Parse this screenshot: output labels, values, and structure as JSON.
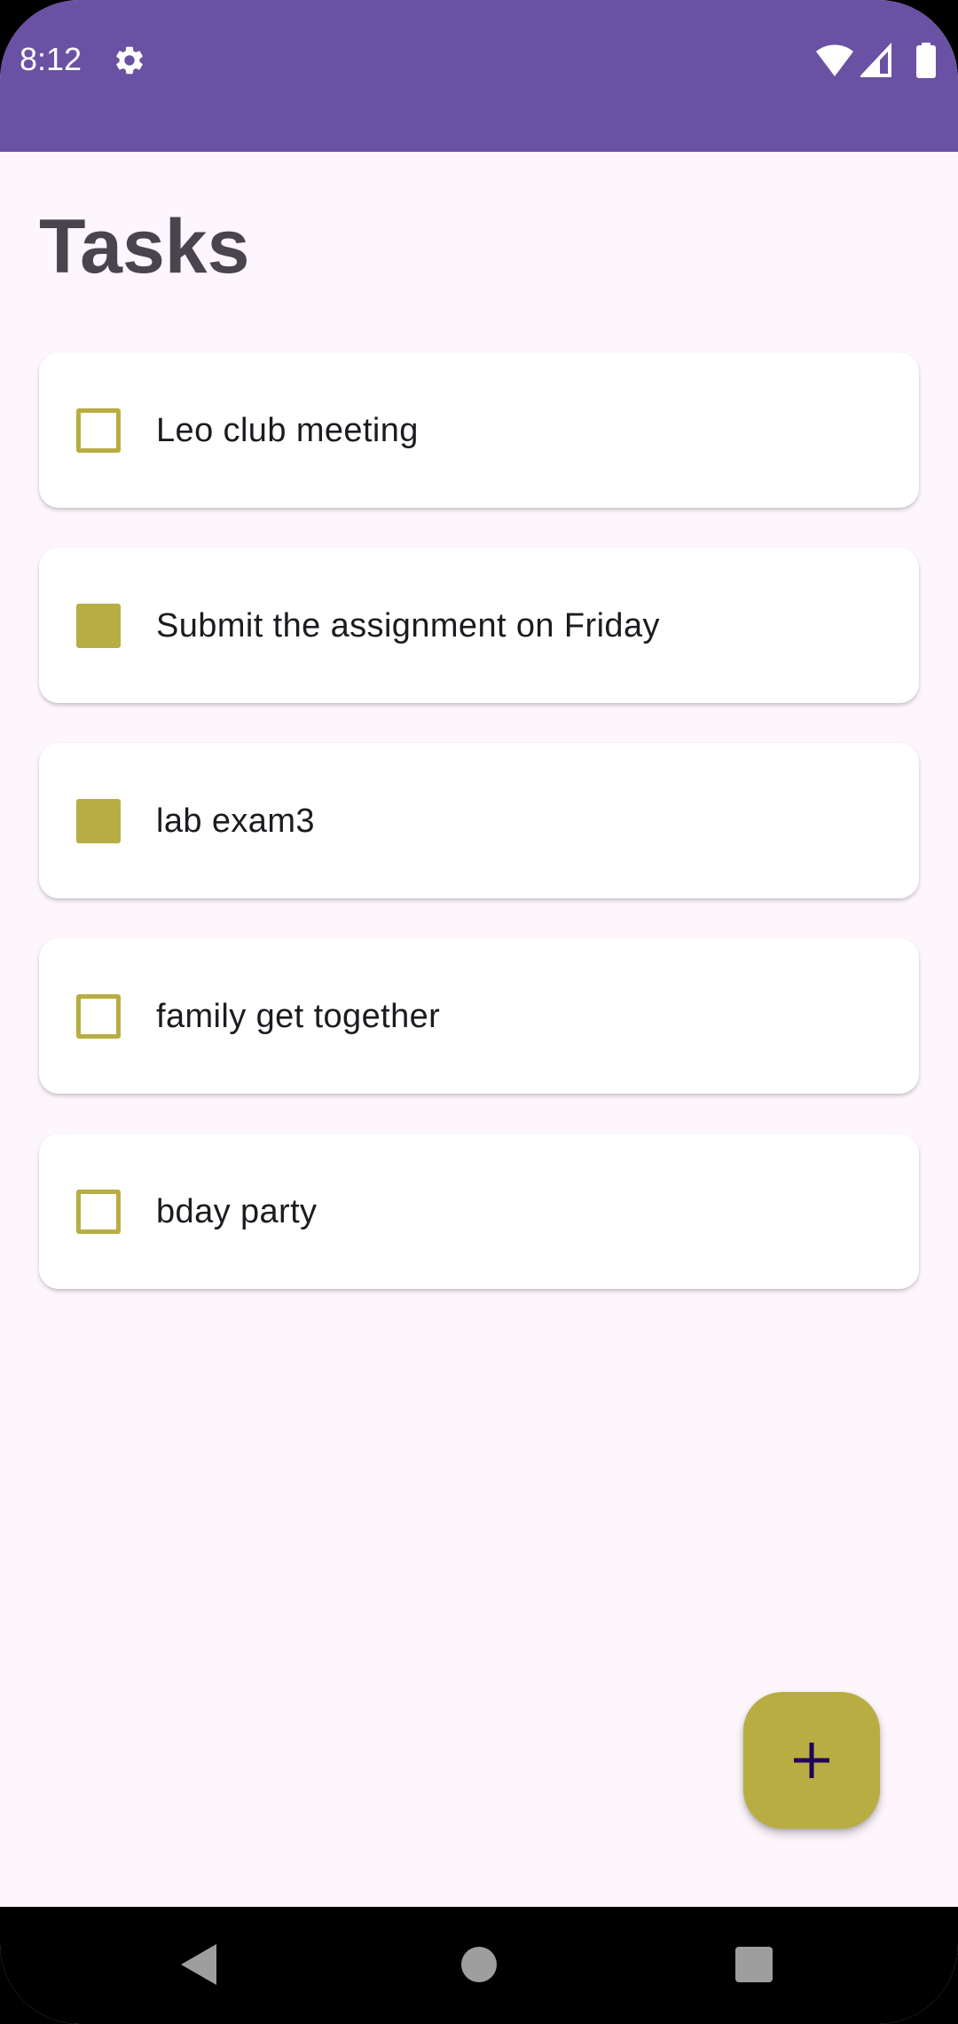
{
  "status_bar": {
    "time": "8:12",
    "background_color": "#6a51a3",
    "icons": [
      "settings-gear-icon",
      "wifi-icon",
      "cell-signal-icon",
      "battery-icon"
    ]
  },
  "screen": {
    "title": "Tasks"
  },
  "tasks": [
    {
      "label": "Leo club meeting",
      "checked": false
    },
    {
      "label": "Submit the assignment on Friday",
      "checked": true
    },
    {
      "label": "lab exam3",
      "checked": true
    },
    {
      "label": "family get together",
      "checked": false
    },
    {
      "label": "bday party",
      "checked": false
    }
  ],
  "fab": {
    "icon": "plus-icon",
    "color": "#b8ad42"
  },
  "navigation_bar": {
    "icons": [
      "back-icon",
      "home-icon",
      "recents-icon"
    ]
  },
  "colors": {
    "accent": "#b8ad42",
    "status_bar": "#6a51a3",
    "background": "#fdf6fc",
    "title_text": "#49454f"
  }
}
